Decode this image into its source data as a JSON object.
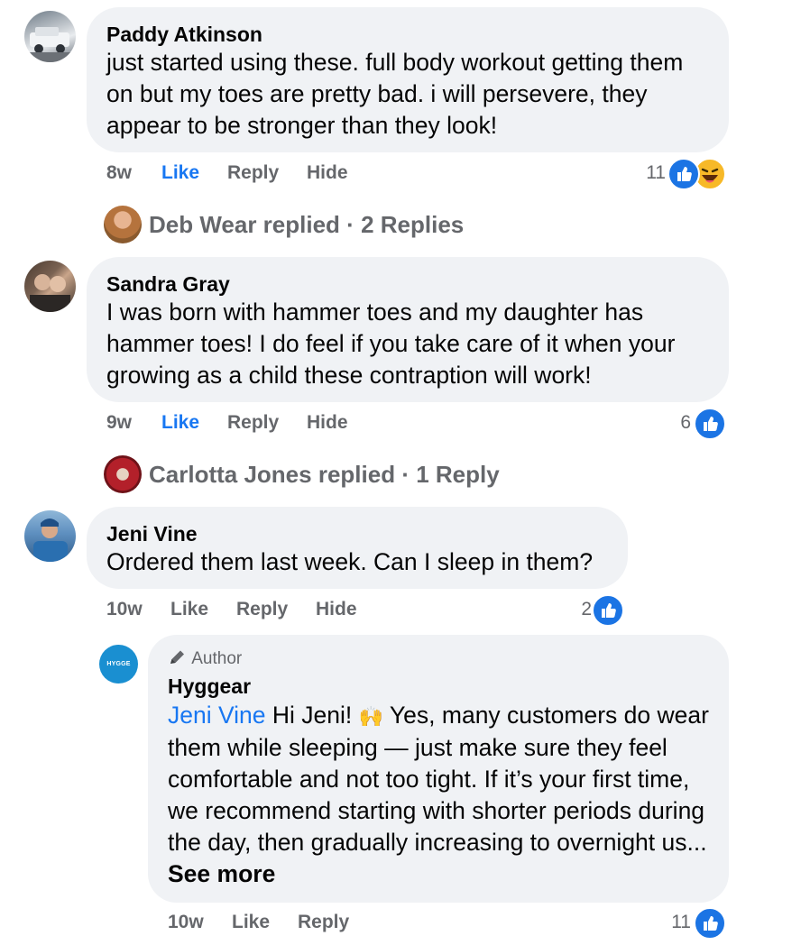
{
  "comments": [
    {
      "author": "Paddy Atkinson",
      "text": "just started using these. full body workout getting them on but my toes are pretty bad. i will persevere, they appear to be stronger than they look!",
      "time": "8w",
      "like": "Like",
      "reply": "Reply",
      "hide": "Hide",
      "reaction_count": "11",
      "reactions": [
        "like-icon",
        "haha-icon"
      ],
      "replied_by": "Deb Wear replied",
      "replies_count": "2 Replies"
    },
    {
      "author": "Sandra Gray",
      "text": "I was born with hammer toes and my daughter has hammer toes! I do feel if you take care of it when your growing as a child these contraption will work!",
      "time": "9w",
      "like": "Like",
      "reply": "Reply",
      "hide": "Hide",
      "reaction_count": "6",
      "reactions": [
        "like-icon"
      ],
      "replied_by": "Carlotta Jones replied",
      "replies_count": "1 Reply"
    },
    {
      "author": "Jeni Vine",
      "text": "Ordered them last week. Can I sleep in them?",
      "time": "10w",
      "like": "Like",
      "reply": "Reply",
      "hide": "Hide",
      "reaction_count": "2",
      "reactions": [
        "like-icon"
      ]
    }
  ],
  "reply": {
    "badge": "Author",
    "avatar_text": "HYGGE",
    "author": "Hyggear",
    "mention": "Jeni Vine",
    "text_lead": " Hi Jeni! ",
    "emoji": "🙌",
    "text_rest": " Yes, many customers do wear them while sleeping — just make sure they feel comfortable and not too tight. If it’s your first time, we recommend starting with shorter periods during the day, then gradually increasing to overnight us...",
    "see_more": "See more",
    "time": "10w",
    "like": "Like",
    "reply": "Reply",
    "reaction_count": "11",
    "reactions": [
      "like-icon"
    ]
  },
  "separator": "·",
  "colors": {
    "bubble": "#f0f2f5",
    "link_blue": "#1877f2",
    "meta_gray": "#65676b",
    "like_blue": "#1b74e4",
    "haha_yellow": "#f7b928"
  }
}
